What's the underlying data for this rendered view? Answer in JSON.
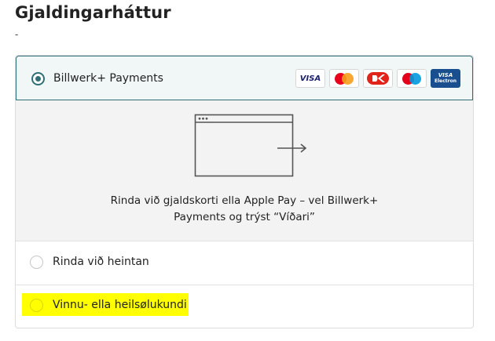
{
  "page": {
    "title": "Gjaldingarháttur",
    "subtitle": "-"
  },
  "payment_methods": [
    {
      "label": "Billwerk+ Payments",
      "selected": true
    },
    {
      "label": "Rinda við heintan",
      "selected": false
    },
    {
      "label": "Vinnu- ella heilsølukundi",
      "selected": false,
      "highlighted": true
    }
  ],
  "cards": {
    "visa": "VISA",
    "mastercard": "mastercard",
    "dankort": "dankort",
    "maestro": "maestro",
    "visa_electron_line1": "VISA",
    "visa_electron_line2": "Electron"
  },
  "redirect_panel": {
    "line1": "Rinda við gjaldskorti ella Apple Pay – vel Billwerk+",
    "line2": "Payments og trýst “Víðari”"
  },
  "colors": {
    "accent": "#2f6f74",
    "selected_bg": "#f1f7f7",
    "panel_bg": "#f3f3f3",
    "highlight": "#ffff00"
  }
}
